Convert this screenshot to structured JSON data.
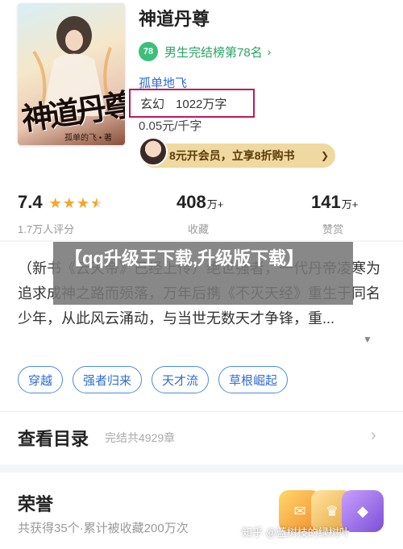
{
  "book": {
    "title": "神道丹尊",
    "rank_badge": "78",
    "rank_text": "男生完结榜第78名",
    "author": "孤单地飞",
    "genre": "玄幻",
    "word_count": "1022万字",
    "price": "0.05元/千字",
    "cover_title": "神道丹尊",
    "cover_author": "孤单的飞 • 著"
  },
  "promo": {
    "label": "8元开会员，立享8折购书"
  },
  "stats": {
    "rating": {
      "value": "7.4",
      "stars": 3.5,
      "label": "1.7万人评分"
    },
    "collect": {
      "value": "408",
      "unit": "万+",
      "label": "收藏"
    },
    "reward": {
      "value": "141",
      "unit": "万+",
      "label": "赞赏"
    }
  },
  "overlay_title": "【qq升级王下载,升级版下载】",
  "description": "（新书《云天帝》已经上传）绝世强者，一代丹帝凌寒为追求成神之路而殒落，万年后携《不灭天经》重生于同名少年，从此风云涌动，与当世无数天才争锋，重...",
  "tags": [
    "穿越",
    "强者归来",
    "天才流",
    "草根崛起"
  ],
  "toc": {
    "title": "查看目录",
    "subtitle": "完结共4929章"
  },
  "honor": {
    "title": "荣誉",
    "subtitle": "共获得35个·累计被收藏200万次"
  },
  "watermark": "知乎 @蓝树枝的绿树叶",
  "colors": {
    "accent_blue": "#2f6ccf",
    "rank_green": "#3cbf7a",
    "star": "#f5a623",
    "highlight_box": "#c2185b"
  }
}
